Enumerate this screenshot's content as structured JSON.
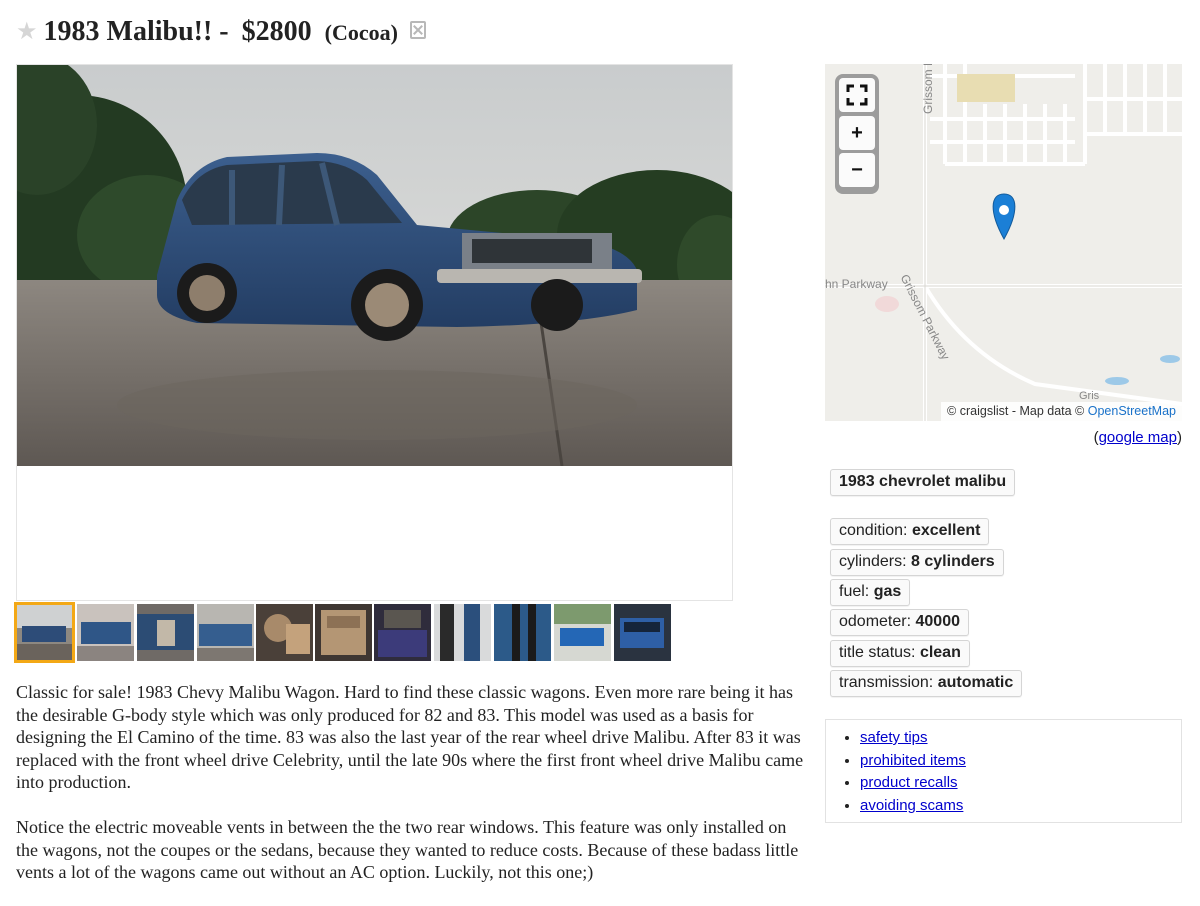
{
  "listing": {
    "title": "1983 Malibu!!",
    "separator": "-",
    "price": "$2800",
    "location": "(Cocoa)",
    "icons": {
      "favorite": "star-icon",
      "hide": "hide-icon"
    }
  },
  "gallery": {
    "thumb_count": 11,
    "selected_index": 0
  },
  "description": [
    "Classic for sale! 1983 Chevy Malibu Wagon. Hard to find these classic wagons. Even more rare being it has the desirable G-body style which was only produced for 82 and 83. This model was used as a basis for designing the El Camino of the time. 83 was also the last year of the rear wheel drive Malibu. After 83 it was replaced with the front wheel drive Celebrity, until the late 90s where the first front wheel drive Malibu came into production.",
    "Notice the electric moveable vents in between the the two rear windows. This feature was only installed on the wagons, not the coupes or the sedans, because they wanted to reduce costs. Because of these badass little vents a lot of the wagons came out without an AC option. Luckily, not this one;)"
  ],
  "map": {
    "controls": {
      "fullscreen": "fullscreen-icon",
      "zoom_in": "+",
      "zoom_out": "−"
    },
    "labels": {
      "street_a": "hn Parkway",
      "street_b": "Grissom Parkway",
      "street_c": "Grissom Pa",
      "street_d": "Gris"
    },
    "attribution_prefix": "© craigslist - Map data ©",
    "attribution_link": "OpenStreetMap",
    "google_prefix": "(",
    "google_link": "google map",
    "google_suffix": ")"
  },
  "attributes": {
    "vehicle": "1983 chevrolet malibu",
    "items": [
      {
        "label": "condition:",
        "value": "excellent"
      },
      {
        "label": "cylinders:",
        "value": "8 cylinders"
      },
      {
        "label": "fuel:",
        "value": "gas"
      },
      {
        "label": "odometer:",
        "value": "40000"
      },
      {
        "label": "title status:",
        "value": "clean"
      },
      {
        "label": "transmission:",
        "value": "automatic"
      }
    ]
  },
  "safety_links": [
    "safety tips",
    "prohibited items",
    "product recalls",
    "avoiding scams"
  ],
  "colors": {
    "link": "#0000cc",
    "selected_thumb": "#f3a816",
    "map_pin": "#1b7fd6",
    "osm_link": "#1a72c9"
  }
}
